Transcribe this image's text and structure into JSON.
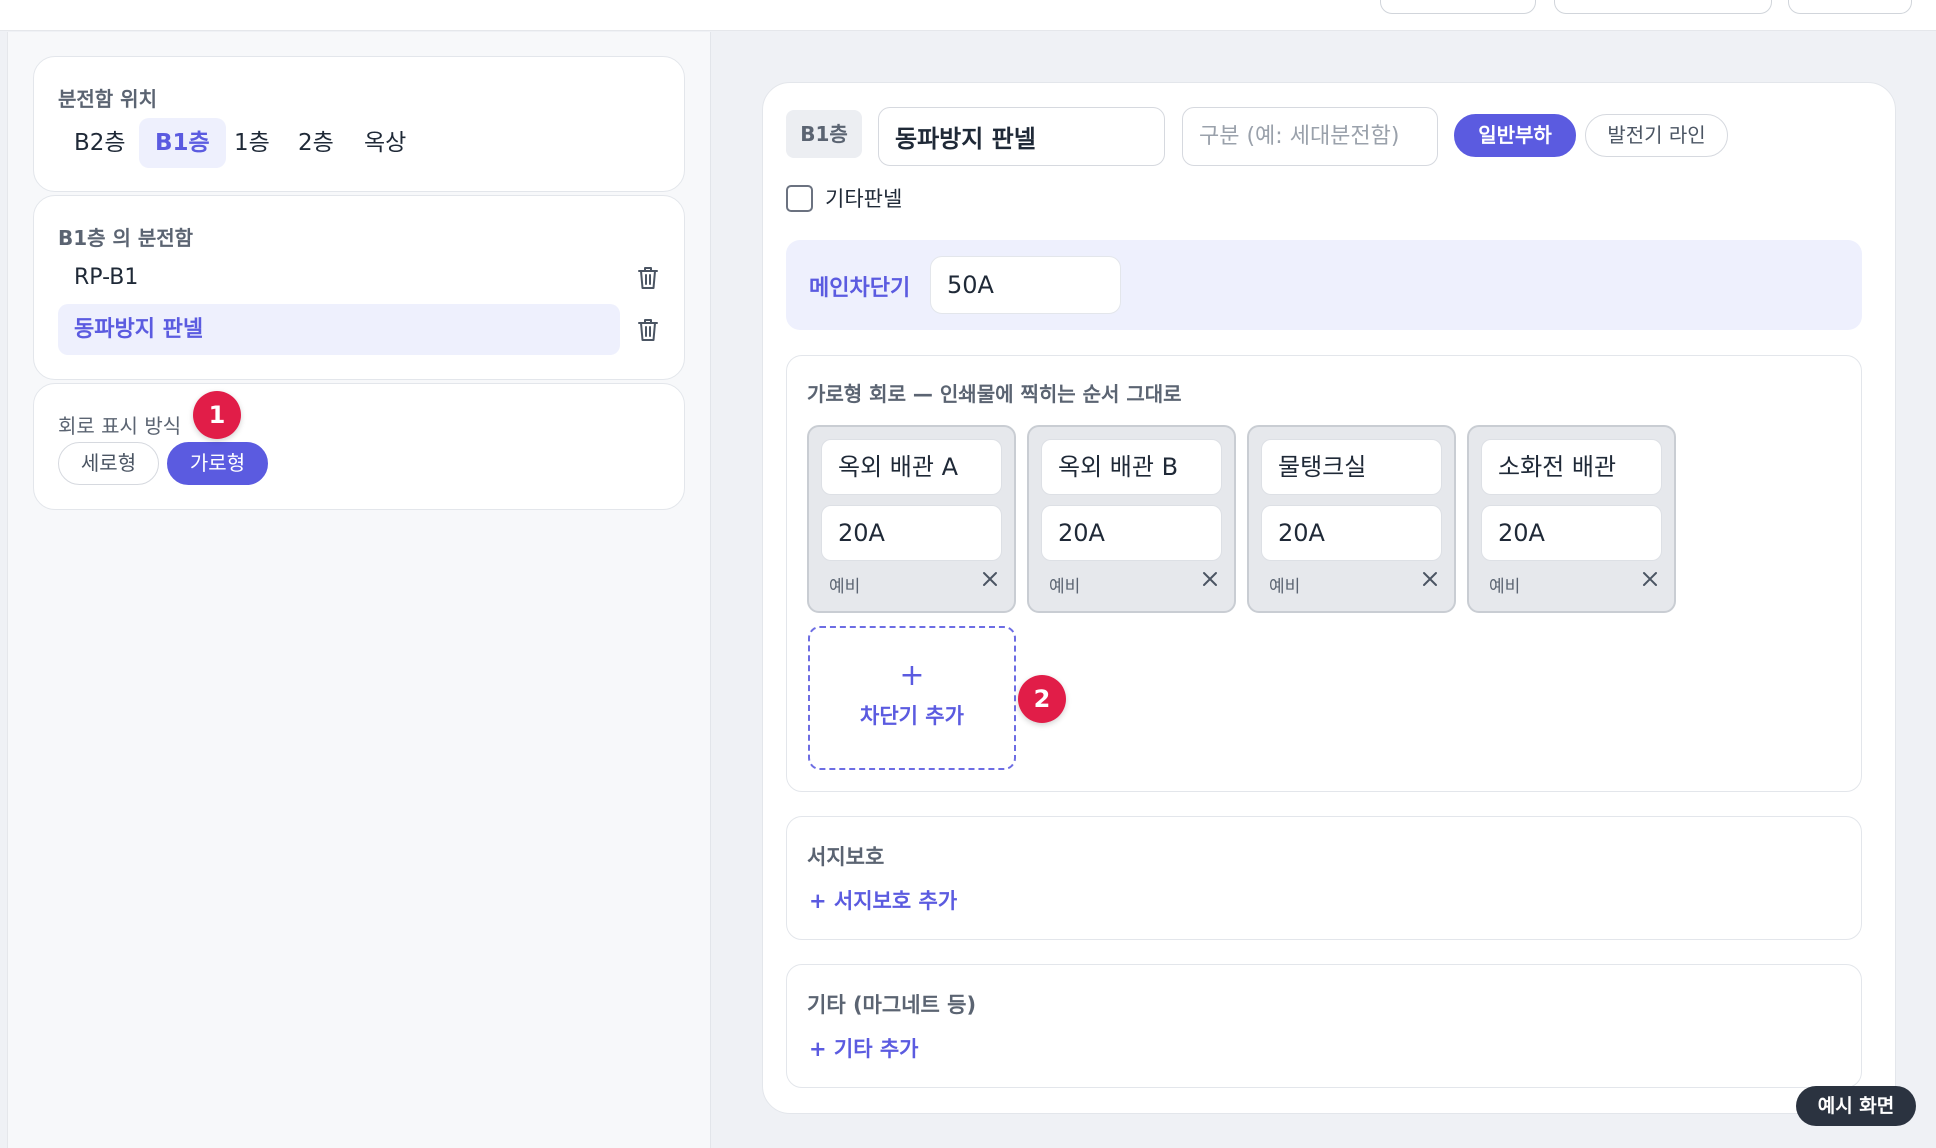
{
  "location": {
    "label": "분전함 위치",
    "floors": [
      "B2층",
      "B1층",
      "1층",
      "2층",
      "옥상"
    ],
    "active_floor": "B1층"
  },
  "panels": {
    "label": "B1층 의 분전함",
    "items": [
      "RP-B1",
      "동파방지 판넬"
    ],
    "active": "동파방지 판넬"
  },
  "display_mode": {
    "label": "회로 표시 방식",
    "options": [
      "세로형",
      "가로형"
    ],
    "active": "가로형"
  },
  "markers": [
    "1",
    "2"
  ],
  "editor": {
    "floor_chip": "B1층",
    "panel_name": "동파방지 판넬",
    "category_placeholder": "구분 (예: 세대분전함)",
    "load_types": [
      "일반부하",
      "발전기 라인"
    ],
    "active_load": "일반부하",
    "other_panel_label": "기타판넬",
    "main_breaker_label": "메인차단기",
    "main_breaker_value": "50A"
  },
  "circuits": {
    "title": "가로형 회로 — 인쇄물에 찍히는 순서 그대로",
    "items": [
      {
        "name": "옥외 배관 A",
        "amp": "20A",
        "spare": "예비"
      },
      {
        "name": "옥외 배관 B",
        "amp": "20A",
        "spare": "예비"
      },
      {
        "name": "물탱크실",
        "amp": "20A",
        "spare": "예비"
      },
      {
        "name": "소화전 배관",
        "amp": "20A",
        "spare": "예비"
      }
    ],
    "add_plus": "+",
    "add_label": "차단기 추가"
  },
  "surge": {
    "title": "서지보호",
    "add": "+ 서지보호 추가"
  },
  "etc": {
    "title": "기타 (마그네트 등)",
    "add": "+ 기타 추가"
  },
  "sample_badge": "예시 화면",
  "colors": {
    "accent": "#5b5be0",
    "marker": "#e11d48"
  }
}
